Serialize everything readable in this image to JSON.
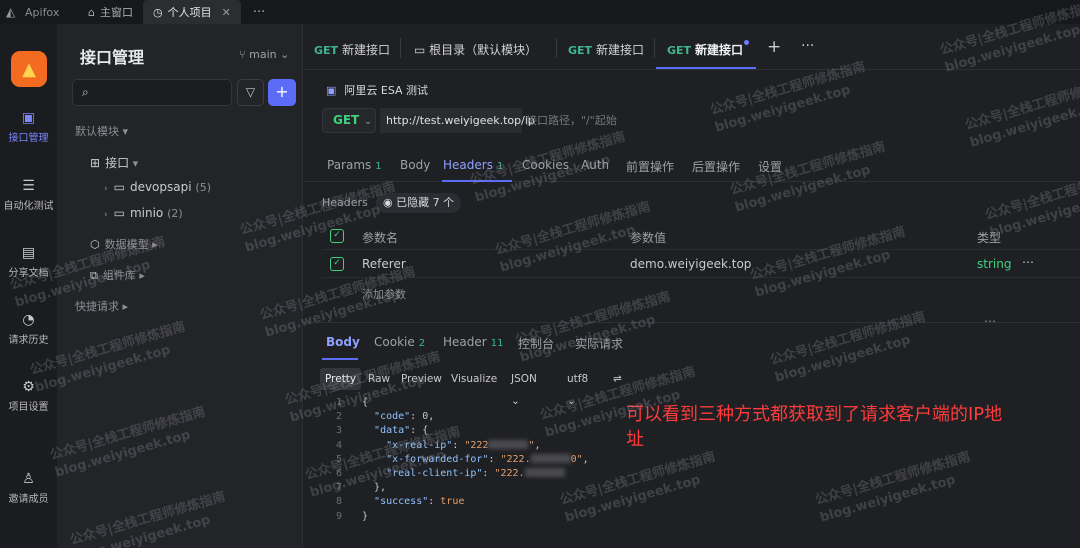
{
  "titlebar": {
    "app_name": "Apifox",
    "tabs": [
      {
        "label": "主窗口",
        "icon": "home-icon"
      },
      {
        "label": "个人项目",
        "icon": "project-icon",
        "active": true
      }
    ],
    "more": "···"
  },
  "rail": {
    "items": [
      {
        "label": "接口管理",
        "icon": "api-icon",
        "active": true
      },
      {
        "label": "自动化测试",
        "icon": "automation-icon"
      },
      {
        "label": "分享文档",
        "icon": "book-icon"
      },
      {
        "label": "请求历史",
        "icon": "clock-icon"
      },
      {
        "label": "项目设置",
        "icon": "gear-icon"
      },
      {
        "label": "邀请成员",
        "icon": "user-add-icon"
      }
    ]
  },
  "sidebar": {
    "title": "接口管理",
    "branch": "main",
    "default_module": "默认模块",
    "api_root": "接口",
    "folders": [
      {
        "name": "devopsapi",
        "count": "(5)"
      },
      {
        "name": "minio",
        "count": "(2)"
      }
    ],
    "data_model": "数据模型",
    "components": "组件库",
    "quick_request": "快捷请求"
  },
  "request_tabs": [
    {
      "method": "GET",
      "label": "新建接口"
    },
    {
      "method": "",
      "label": "根目录（默认模块）"
    },
    {
      "method": "GET",
      "label": "新建接口"
    },
    {
      "method": "GET",
      "label": "新建接口",
      "active": true
    }
  ],
  "request": {
    "name": "阿里云 ESA 测试",
    "method": "GET",
    "url": "http://test.weiyigeek.top/ip",
    "path_hint": "接口路径，\"/\"起始"
  },
  "request_subtabs": [
    {
      "label": "Params",
      "count": "1"
    },
    {
      "label": "Body",
      "count": ""
    },
    {
      "label": "Headers",
      "count": "1",
      "active": true
    },
    {
      "label": "Cookies",
      "count": ""
    },
    {
      "label": "Auth",
      "count": ""
    },
    {
      "label": "前置操作",
      "count": ""
    },
    {
      "label": "后置操作",
      "count": ""
    },
    {
      "label": "设置",
      "count": ""
    }
  ],
  "headers": {
    "label": "Headers",
    "hidden_chip": "已隐藏 7 个",
    "columns": [
      "参数名",
      "参数值",
      "类型"
    ],
    "rows": [
      {
        "name": "Referer",
        "value": "demo.weiyigeek.top",
        "type": "string"
      }
    ],
    "add_param": "添加参数"
  },
  "response_tabs": [
    {
      "label": "Body",
      "count": "",
      "active": true
    },
    {
      "label": "Cookie",
      "count": "2"
    },
    {
      "label": "Header",
      "count": "11"
    },
    {
      "label": "控制台",
      "count": ""
    },
    {
      "label": "实际请求",
      "count": ""
    }
  ],
  "format_bar": [
    "Pretty",
    "Raw",
    "Preview",
    "Visualize",
    "JSON",
    "utf8"
  ],
  "response_body": {
    "code": "0",
    "real_ip": "\"222",
    "forwarded_for": "\"222.",
    "forwarded_for_tail": "0\"",
    "real_client_ip": "\"222.",
    "success": "true"
  },
  "annotation": "可以看到三种方式都获取到了请求客户端的IP地址",
  "watermark": {
    "line1": "公众号|全栈工程师修炼指南",
    "line2": "blog.weiyigeek.top"
  }
}
